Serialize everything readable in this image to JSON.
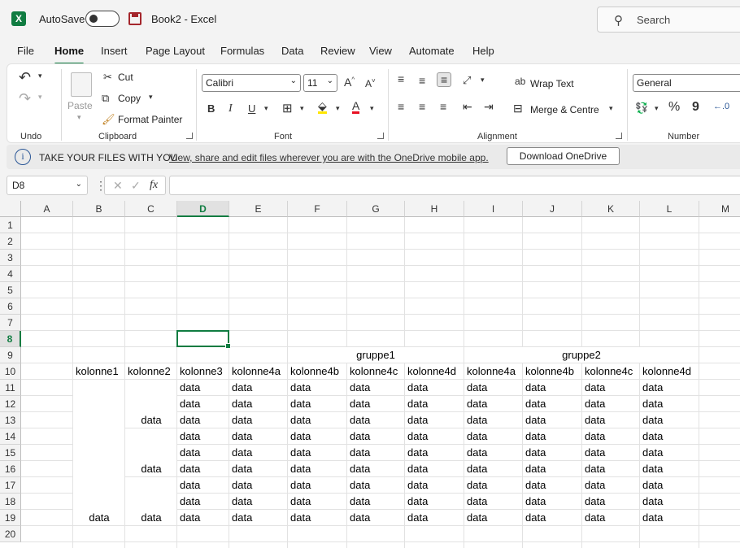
{
  "titlebar": {
    "autosave_label": "AutoSave",
    "doc_title": "Book2  -  Excel",
    "search_placeholder": "Search"
  },
  "menu_tabs": [
    "File",
    "Home",
    "Insert",
    "Page Layout",
    "Formulas",
    "Data",
    "Review",
    "View",
    "Automate",
    "Help"
  ],
  "active_tab": "Home",
  "ribbon": {
    "undo_group": "Undo",
    "clipboard": {
      "paste": "Paste",
      "cut": "Cut",
      "copy": "Copy",
      "format_painter": "Format Painter",
      "group": "Clipboard"
    },
    "font": {
      "family": "Calibri",
      "size": "11",
      "bold": "B",
      "italic": "I",
      "underline": "U",
      "grow": "A^",
      "shrink": "A˅",
      "group": "Font",
      "font_color_letter": "A"
    },
    "alignment": {
      "wrap_text": "Wrap Text",
      "merge_centre": "Merge & Centre",
      "group": "Alignment"
    },
    "number": {
      "format": "General",
      "percent": "%",
      "comma": "9",
      "group": "Number"
    }
  },
  "infobar": {
    "title": "TAKE YOUR FILES WITH YOU",
    "link": "View, share and edit files wherever you are with the OneDrive mobile app.",
    "button": "Download OneDrive"
  },
  "formula_bar": {
    "name_box": "D8",
    "fx": "fx",
    "content": ""
  },
  "sheet": {
    "columns": [
      "A",
      "B",
      "C",
      "D",
      "E",
      "F",
      "G",
      "H",
      "I",
      "J",
      "K",
      "L",
      "M"
    ],
    "selected_column": "D",
    "rows": [
      "1",
      "2",
      "3",
      "4",
      "5",
      "6",
      "7",
      "8",
      "9",
      "10",
      "11",
      "12",
      "13",
      "14",
      "15",
      "16",
      "17",
      "18",
      "19",
      "20"
    ],
    "selected_row": "8",
    "group_headers": {
      "gruppe1": "gruppe1",
      "gruppe2": "gruppe2"
    },
    "headers": [
      "kolonne1",
      "kolonne2",
      "kolonne3",
      "kolonne4a",
      "kolonne4b",
      "kolonne4c",
      "kolonne4d",
      "kolonne4a",
      "kolonne4b",
      "kolonne4c",
      "kolonne4d"
    ],
    "data_value": "data",
    "merged_col_c": [
      "data",
      "data",
      "data"
    ],
    "merged_col_b": "data"
  }
}
